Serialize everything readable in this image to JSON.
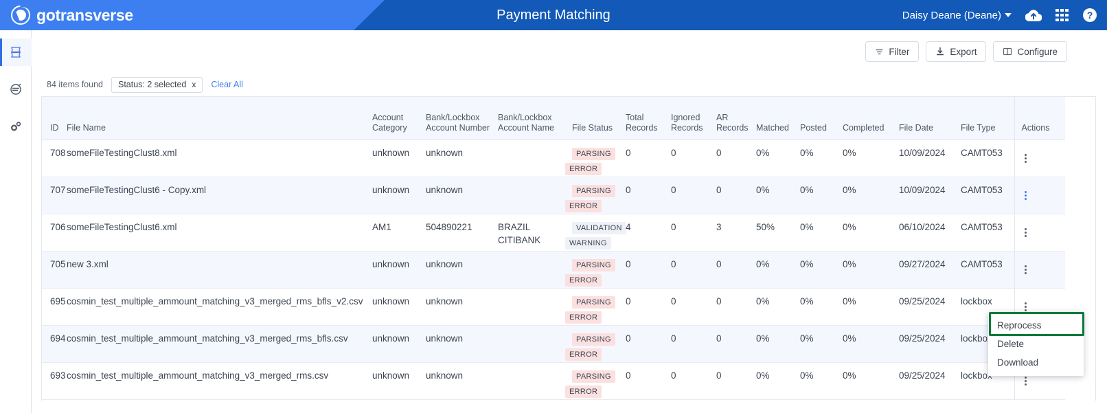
{
  "header": {
    "brand": "gotransverse",
    "title": "Payment Matching",
    "user": "Daisy Deane (Deane)",
    "icons": [
      "cloud-upload-icon",
      "apps-grid-icon",
      "help-icon"
    ],
    "brand_bg": "#3d7ff0",
    "bar_bg": "#1259b8"
  },
  "sidebar": {
    "items": [
      {
        "name": "data-files",
        "icon": "stack-icon",
        "active": true
      },
      {
        "name": "reprocess",
        "icon": "circle-lines-icon",
        "active": false
      },
      {
        "name": "settings",
        "icon": "gears-icon",
        "active": false
      }
    ]
  },
  "toolbar": {
    "filter_label": "Filter",
    "export_label": "Export",
    "configure_label": "Configure"
  },
  "filterbar": {
    "items_found": "84 items found",
    "chip_label": "Status: 2 selected",
    "chip_close": "x",
    "clear_all": "Clear All"
  },
  "table": {
    "columns": [
      "ID",
      "File Name",
      "Account Category",
      "Bank/Lockbox Account Number",
      "Bank/Lockbox Account Name",
      "File Status",
      "Total Records",
      "Ignored Records",
      "AR Records",
      "Matched",
      "Posted",
      "Completed",
      "File Date",
      "File Type",
      "Actions"
    ],
    "rows": [
      {
        "id": "708",
        "file_name": "someFileTestingClust8.xml",
        "account_category": "unknown",
        "bank_account_number": "unknown",
        "bank_account_name": "",
        "status_line1": "PARSING",
        "status_line2": "ERROR",
        "status_kind": "err",
        "total_records": "0",
        "ignored_records": "0",
        "ar_records": "0",
        "matched": "0%",
        "posted": "0%",
        "completed": "0%",
        "file_date": "10/09/2024",
        "file_type": "CAMT053"
      },
      {
        "id": "707",
        "file_name": "someFileTestingClust6 - Copy.xml",
        "account_category": "unknown",
        "bank_account_number": "unknown",
        "bank_account_name": "",
        "status_line1": "PARSING",
        "status_line2": "ERROR",
        "status_kind": "err",
        "total_records": "0",
        "ignored_records": "0",
        "ar_records": "0",
        "matched": "0%",
        "posted": "0%",
        "completed": "0%",
        "file_date": "10/09/2024",
        "file_type": "CAMT053"
      },
      {
        "id": "706",
        "file_name": "someFileTestingClust6.xml",
        "account_category": "AM1",
        "bank_account_number": "504890221",
        "bank_account_name": "BRAZIL CITIBANK",
        "status_line1": "VALIDATION",
        "status_line2": "WARNING",
        "status_kind": "warn",
        "total_records": "4",
        "ignored_records": "0",
        "ar_records": "3",
        "matched": "50%",
        "posted": "0%",
        "completed": "0%",
        "file_date": "06/10/2024",
        "file_type": "CAMT053"
      },
      {
        "id": "705",
        "file_name": "new 3.xml",
        "account_category": "unknown",
        "bank_account_number": "unknown",
        "bank_account_name": "",
        "status_line1": "PARSING",
        "status_line2": "ERROR",
        "status_kind": "err",
        "total_records": "0",
        "ignored_records": "0",
        "ar_records": "0",
        "matched": "0%",
        "posted": "0%",
        "completed": "0%",
        "file_date": "09/27/2024",
        "file_type": "CAMT053"
      },
      {
        "id": "695",
        "file_name": "cosmin_test_multiple_ammount_matching_v3_merged_rms_bfls_v2.csv",
        "account_category": "unknown",
        "bank_account_number": "unknown",
        "bank_account_name": "",
        "status_line1": "PARSING",
        "status_line2": "ERROR",
        "status_kind": "err",
        "total_records": "0",
        "ignored_records": "0",
        "ar_records": "0",
        "matched": "0%",
        "posted": "0%",
        "completed": "0%",
        "file_date": "09/25/2024",
        "file_type": "lockbox"
      },
      {
        "id": "694",
        "file_name": "cosmin_test_multiple_ammount_matching_v3_merged_rms_bfls.csv",
        "account_category": "unknown",
        "bank_account_number": "unknown",
        "bank_account_name": "",
        "status_line1": "PARSING",
        "status_line2": "ERROR",
        "status_kind": "err",
        "total_records": "0",
        "ignored_records": "0",
        "ar_records": "0",
        "matched": "0%",
        "posted": "0%",
        "completed": "0%",
        "file_date": "09/25/2024",
        "file_type": "lockbox"
      },
      {
        "id": "693",
        "file_name": "cosmin_test_multiple_ammount_matching_v3_merged_rms.csv",
        "account_category": "unknown",
        "bank_account_number": "unknown",
        "bank_account_name": "",
        "status_line1": "PARSING",
        "status_line2": "ERROR",
        "status_kind": "err",
        "total_records": "0",
        "ignored_records": "0",
        "ar_records": "0",
        "matched": "0%",
        "posted": "0%",
        "completed": "0%",
        "file_date": "09/25/2024",
        "file_type": "lockbox"
      }
    ]
  },
  "context_menu": {
    "items": [
      "Reprocess",
      "Delete",
      "Download"
    ],
    "highlighted": "Reprocess",
    "highlight_color": "#0a7a3c"
  }
}
